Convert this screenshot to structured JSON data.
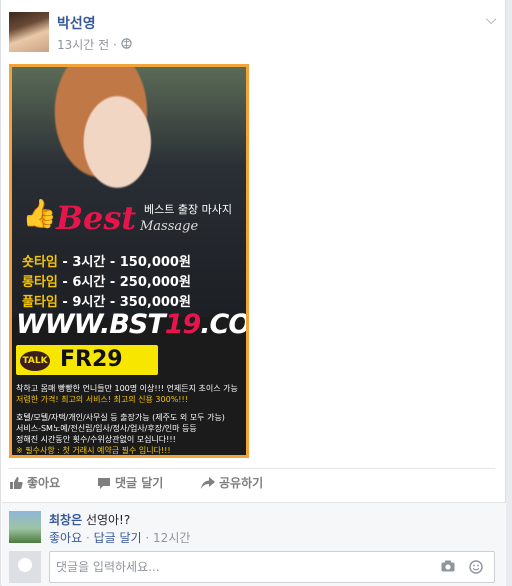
{
  "post": {
    "author": "박선영",
    "time": "13시간 전 ·",
    "privacy_icon": "globe-icon"
  },
  "ad": {
    "tagline": "베스트 출장 마사지",
    "brand": "Best",
    "brand_sub": "Massage",
    "prices": [
      {
        "k": "숏타임",
        "v": " - 3시간 - 150,000원"
      },
      {
        "k": "롱타임",
        "v": " - 6시간 - 250,000원"
      },
      {
        "k": "풀타임",
        "v": " - 9시간 - 350,000원"
      }
    ],
    "url_prefix": "WWW.BST",
    "url_red": "19",
    "url_suffix": ".COM",
    "talk": "TALK",
    "kakao_id": "FR29",
    "fine": [
      "착하고 몸매 빵빵한 언니들만 100명 이상!!! 언제든지 초이스 가능",
      "저렴한 가격! 최고의 서비스! 최고의 신용 300%!!!",
      "",
      "호텔/모텔/자택/개인/사무실 등 출장가능 (제주도 외 모두 가능)",
      "서비스-SM노예/전신립/입사/정사/업사/후장/인마 등등",
      "정해진 시간동안 횟수/수위상관없이 모십니다!!!",
      "※ 필수사항 : 첫 거래시 예약금 필수 입니다!!!"
    ]
  },
  "actions": {
    "like": "좋아요",
    "comment": "댓글 달기",
    "share": "공유하기"
  },
  "comment": {
    "author": "최창은",
    "text": " 선영아!?",
    "like": "좋아요",
    "reply": "답글 달기",
    "time": "12시간"
  },
  "composer": {
    "placeholder": "댓글을 입력하세요..."
  }
}
